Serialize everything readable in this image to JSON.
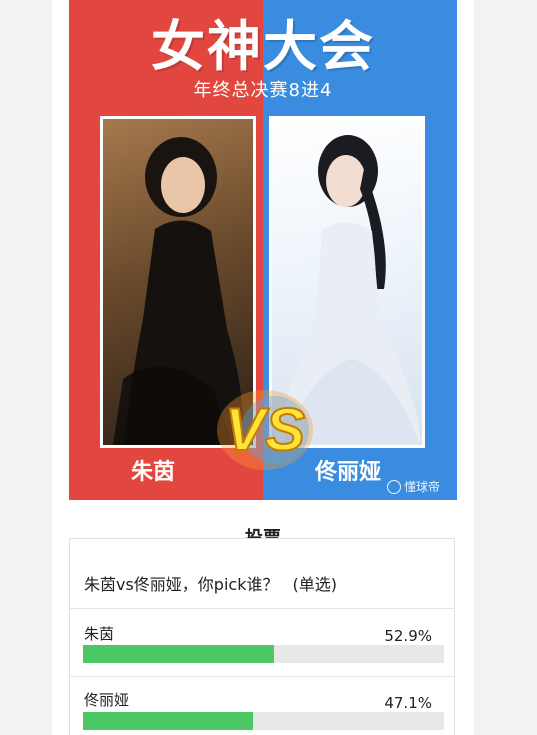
{
  "poster": {
    "title": "女神大会",
    "subtitle": "年终总决赛8进4",
    "vs_text": "VS",
    "left_name": "朱茵",
    "right_name": "佟丽娅",
    "watermark": "懂球帝",
    "colors": {
      "left": "#e2473f",
      "right": "#3a8ce0"
    }
  },
  "vote": {
    "title": "投票",
    "question": "朱茵vs佟丽娅，你pick谁？",
    "mode": "(单选)",
    "options": [
      {
        "label": "朱茵",
        "percent_text": "52.9%",
        "percent": 52.9
      },
      {
        "label": "佟丽娅",
        "percent_text": "47.1%",
        "percent": 47.1
      }
    ],
    "bar_color": "#4cc864"
  }
}
